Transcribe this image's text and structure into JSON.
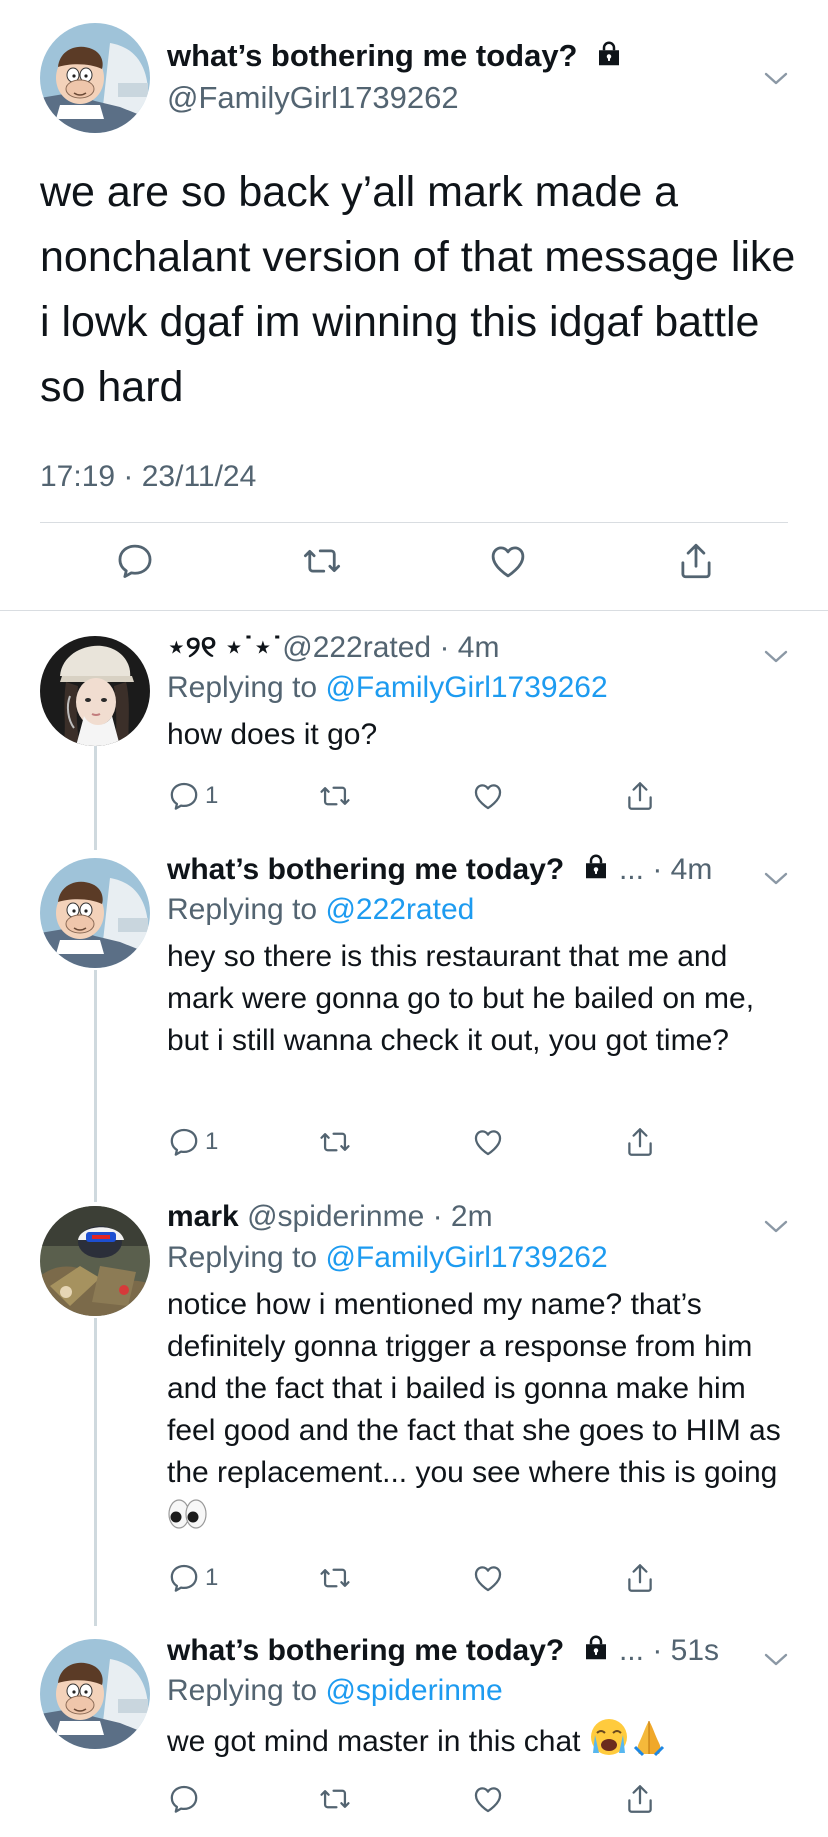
{
  "main_tweet": {
    "author_name": "what’s bothering me today?",
    "author_handle": "@FamilyGirl1739262",
    "text": "we are so back y’all mark made a nonchalant version of that message like i lowk dgaf im winning this idgaf battle so hard",
    "timestamp": "17:19 · 23/11/24",
    "lock_icon": "lock-icon",
    "actions": [
      "reply-icon",
      "retweet-icon",
      "like-icon",
      "share-icon"
    ]
  },
  "replies": [
    {
      "author_name": "⋆୨୧ ⋆˙⋆˙",
      "handle": "@222rated",
      "time": "· 4m",
      "replying_prefix": "Replying to ",
      "replying_to": "@FamilyGirl1739262",
      "text": "how does it go?",
      "reply_count": "1"
    },
    {
      "author_name": "what’s bothering me today?",
      "handle": "...",
      "time": "· 4m",
      "replying_prefix": "Replying to ",
      "replying_to": "@222rated",
      "text": "hey so there is this restaurant that me and mark were gonna go to but he bailed on me, but i still wanna check it out, you got time?",
      "reply_count": "1"
    },
    {
      "author_name": "mark",
      "handle": "@spiderinme",
      "time": "· 2m",
      "replying_prefix": "Replying to ",
      "replying_to": "@FamilyGirl1739262",
      "text": "notice how i mentioned my name? that’s definitely gonna trigger a response from him and the fact that i bailed is gonna make him feel good and the fact that she goes to HIM as the replacement... you see where this is going",
      "emoji": "eyes-emoji",
      "reply_count": "1"
    },
    {
      "author_name": "what’s bothering me today?",
      "handle": "...",
      "time": "· 51s",
      "replying_prefix": "Replying to ",
      "replying_to": "@spiderinme",
      "text": "we got mind master in this chat",
      "emoji": "crying-praying-emoji",
      "reply_count": ""
    }
  ],
  "colors": {
    "text": "#0f1419",
    "secondary": "#536471",
    "link": "#1d9bf0",
    "divider": "#d9dde1"
  }
}
